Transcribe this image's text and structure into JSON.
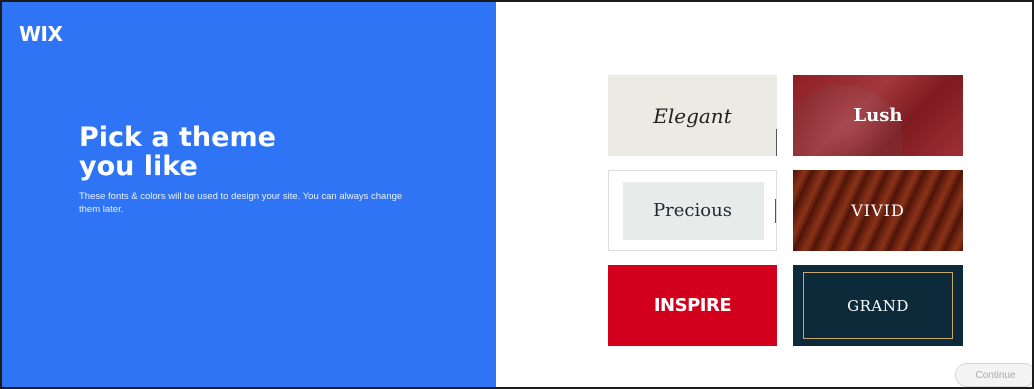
{
  "brand": {
    "logo_text": "WIX"
  },
  "intro": {
    "headline_line1": "Pick a theme",
    "headline_line2": "you like",
    "description": "These fonts & colors will be used to design your site. You can always change them later."
  },
  "themes": [
    {
      "label": "Elegant",
      "color": "#ecebe3"
    },
    {
      "label": "Lush",
      "color": "#8f1e24"
    },
    {
      "label": "Precious",
      "color": "#e7ebe9"
    },
    {
      "label": "VIVID",
      "color": "#6e2410"
    },
    {
      "label": "INSPIRE",
      "color": "#d2001c"
    },
    {
      "label": "GRAND",
      "color": "#0d2a3a"
    }
  ],
  "footer": {
    "continue_label": "Continue"
  },
  "colors": {
    "panel_accent": "#2f74f5"
  }
}
